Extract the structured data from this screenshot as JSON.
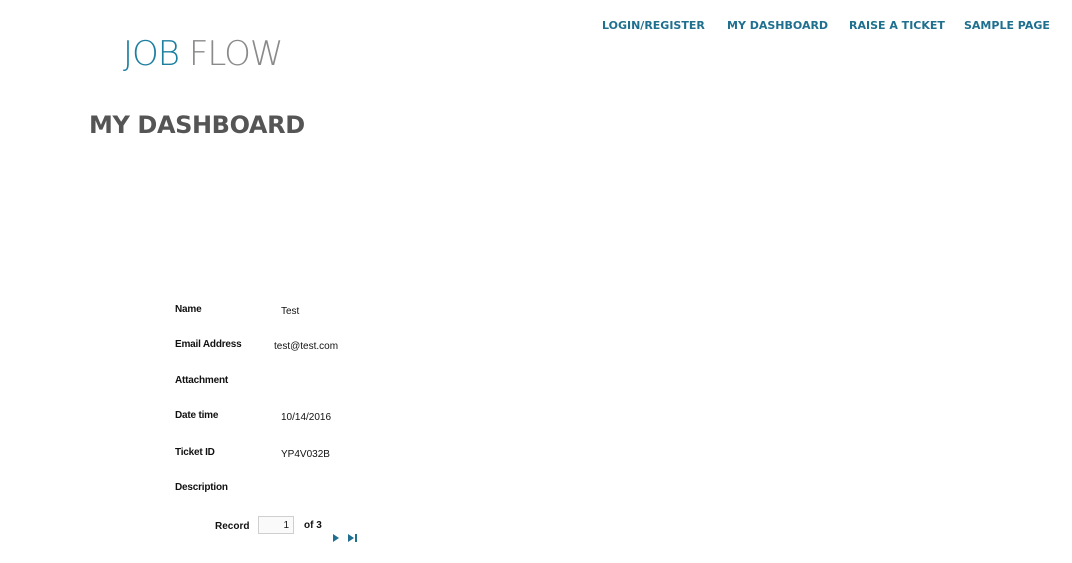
{
  "brand": {
    "logo_part1": "JOB",
    "logo_part2": " FLOW"
  },
  "nav": {
    "items": [
      {
        "label": "LOGIN/REGISTER"
      },
      {
        "label": "MY DASHBOARD"
      },
      {
        "label": "RAISE A TICKET"
      },
      {
        "label": "SAMPLE PAGE"
      }
    ]
  },
  "page": {
    "title": "MY DASHBOARD"
  },
  "record": {
    "fields": [
      {
        "label": "Name",
        "value": "Test"
      },
      {
        "label": "Email Address",
        "value": "test@test.com"
      },
      {
        "label": "Attachment",
        "value": ""
      },
      {
        "label": "Date time",
        "value": "10/14/2016"
      },
      {
        "label": "Ticket ID",
        "value": "YP4V032B"
      },
      {
        "label": "Description",
        "value": ""
      }
    ]
  },
  "pager": {
    "label": "Record",
    "current": "1",
    "of_text": "of 3",
    "next_icon": "next-arrow-icon",
    "last_icon": "last-page-icon"
  },
  "colors": {
    "brand_teal": "#1d7fa0",
    "brand_gray": "#8a8a8a",
    "nav_link": "#1f6f8f",
    "title_gray": "#555555"
  }
}
